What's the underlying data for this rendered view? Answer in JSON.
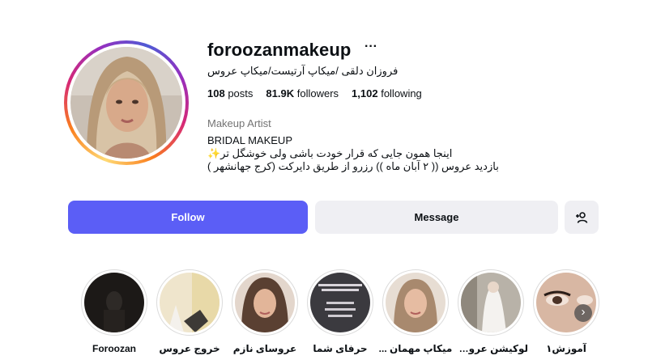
{
  "profile": {
    "username": "foroozanmakeup",
    "more_icon": "more-horizontal-icon",
    "full_name": "فروزان دلقی /میکاپ آرتیست/میکاپ عروس",
    "stats": {
      "posts_value": "108",
      "posts_label": "posts",
      "followers_value": "81.9K",
      "followers_label": "followers",
      "following_value": "1,102",
      "following_label": "following"
    },
    "category": "Makeup Artist",
    "bio": [
      "BRIDAL MAKEUP",
      "اینجا همون جایی که قرار خودت باشی ولی خوشگل تر✨",
      "بازدید عروس (( ۲ آبان ماه )) رزرو از طریق دایرکت (کرج جهانشهر )"
    ]
  },
  "actions": {
    "follow_label": "Follow",
    "message_label": "Message",
    "suggest_icon": "add-person-icon"
  },
  "highlights": [
    {
      "label": "Foroozan"
    },
    {
      "label": "خروج عروس"
    },
    {
      "label": "عروسای نازم"
    },
    {
      "label": "حرفای شما"
    },
    {
      "label": "میکاپ مهمان ..."
    },
    {
      "label": "لوکیشن عروس..."
    },
    {
      "label": "آموزش۱"
    }
  ],
  "highlight_next_icon": "chevron-right-icon",
  "colors": {
    "follow_button": "#5b5ef6",
    "secondary_button": "#efeff3",
    "muted_text": "#737373"
  }
}
